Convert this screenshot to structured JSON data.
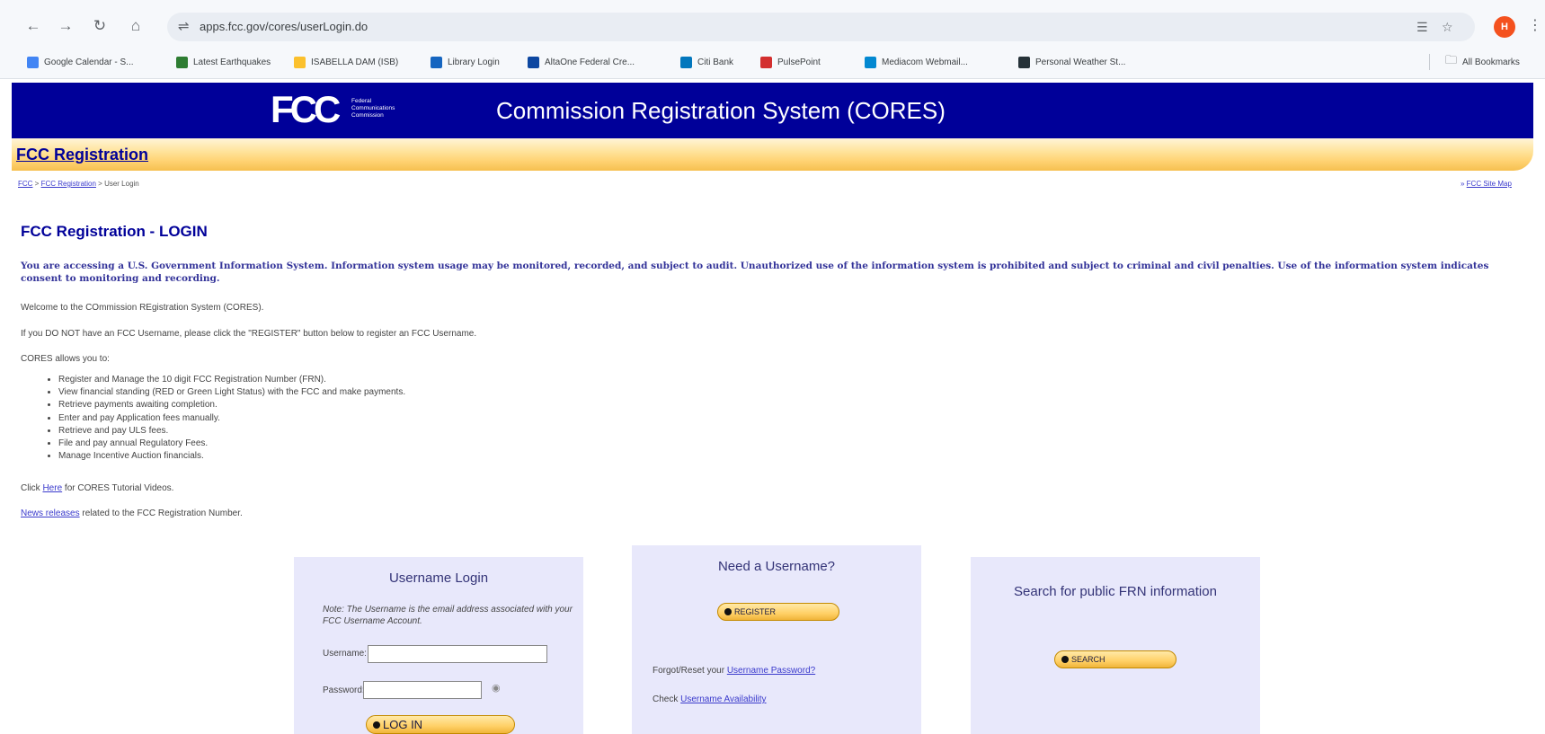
{
  "browser": {
    "url": "apps.fcc.gov/cores/userLogin.do",
    "avatar_letter": "H",
    "bookmarks": [
      {
        "label": "Google Calendar - S...",
        "color": "#4285f4"
      },
      {
        "label": "Latest Earthquakes",
        "color": "#2e7d32"
      },
      {
        "label": "ISABELLA DAM (ISB)",
        "color": "#fbc02d"
      },
      {
        "label": "Library Login",
        "color": "#1565c0"
      },
      {
        "label": "AltaOne Federal Cre...",
        "color": "#0d47a1"
      },
      {
        "label": "Citi Bank",
        "color": "#0277bd"
      },
      {
        "label": "PulsePoint",
        "color": "#d32f2f"
      },
      {
        "label": "Mediacom Webmail...",
        "color": "#0288d1"
      },
      {
        "label": "Personal Weather St...",
        "color": "#263238"
      }
    ],
    "all_bookmarks": "All Bookmarks"
  },
  "header": {
    "logo": "FCC",
    "logo_text": [
      "Federal",
      "Communications",
      "Commission"
    ],
    "title": "Commission Registration System (CORES)",
    "section": "FCC Registration",
    "breadcrumb": {
      "fcc": "FCC",
      "sep": " > ",
      "registration": "FCC Registration",
      "current": "User Login"
    },
    "site_map": "FCC Site Map"
  },
  "content": {
    "title": "FCC Registration - LOGIN",
    "warning": "You are accessing a U.S. Government Information System. Information system usage may be monitored, recorded, and subject to audit. Unauthorized use of the information system is prohibited and subject to criminal and civil penalties. Use of the information system indicates consent to monitoring and recording.",
    "welcome": "Welcome to the COmmission REgistration System (CORES).",
    "no_username": "If you DO NOT have an FCC Username, please click the \"REGISTER\" button below to register an FCC Username.",
    "allows_intro": "CORES allows you to:",
    "features": [
      "Register and Manage the 10 digit FCC Registration Number (FRN).",
      "View financial standing (RED or Green Light Status) with the FCC and make payments.",
      "Retrieve payments awaiting completion.",
      "Enter and pay Application fees manually.",
      "Retrieve and pay ULS fees.",
      "File and pay annual Regulatory Fees.",
      "Manage Incentive Auction financials."
    ],
    "tutorial_prefix": "Click ",
    "tutorial_link": "Here",
    "tutorial_suffix": " for CORES Tutorial Videos.",
    "news_link": "News releases",
    "news_suffix": " related to the FCC Registration Number."
  },
  "login_box": {
    "title": "Username Login",
    "note": "Note: The Username is the email address associated with your FCC Username Account.",
    "username_label": "Username:",
    "username_value": "",
    "password_label": "Password:",
    "password_value": "",
    "login_button": "LOG IN"
  },
  "register_box": {
    "title": "Need a Username?",
    "register_button": "REGISTER",
    "forgot_prefix": "Forgot/Reset your ",
    "forgot_link": "Username Password?",
    "check_prefix": "Check ",
    "check_link": "Username Availability"
  },
  "search_box": {
    "title": "Search for public FRN information",
    "search_button": "SEARCH"
  }
}
